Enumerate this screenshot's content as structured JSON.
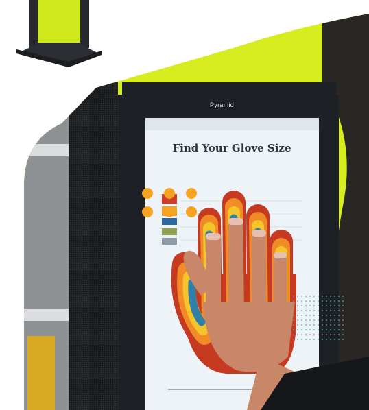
{
  "kiosk": {
    "brand": "Pyramid",
    "title": "Find Your Glove Size",
    "subtitle": "",
    "footer": ""
  },
  "colors": {
    "accent_lime": "#d9ef1d",
    "dots_orange": "#f6a321",
    "kiosk_dark": "#1d2024",
    "screen_bg": "#eef3f7",
    "teal_dots": "#4fb0b9"
  }
}
